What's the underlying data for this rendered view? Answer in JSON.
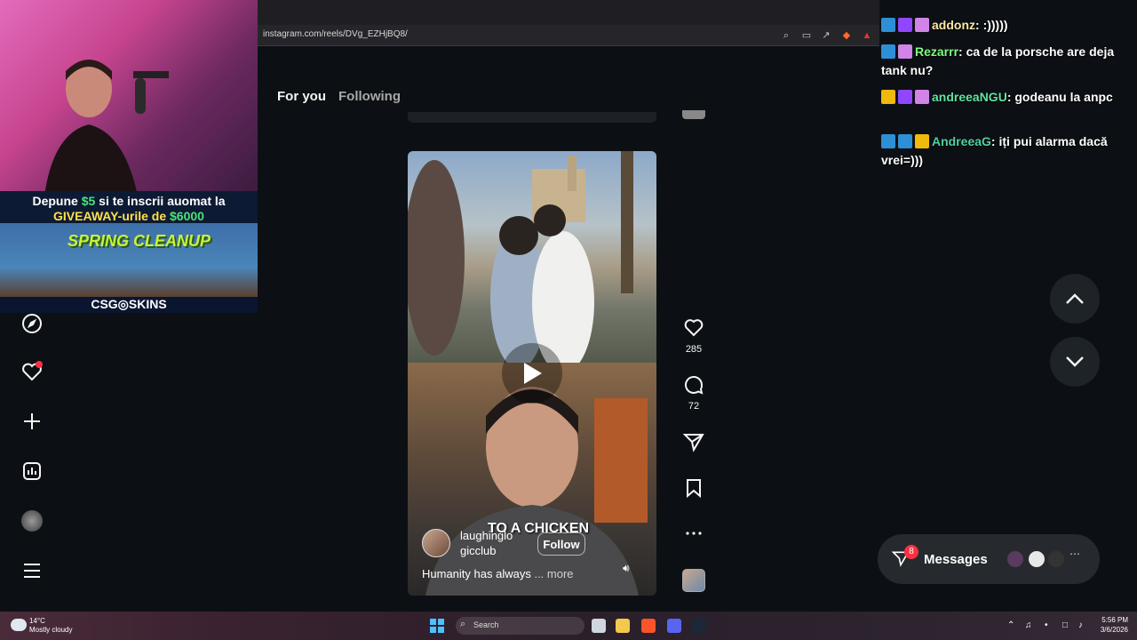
{
  "browser": {
    "url": "instagram.com/reels/DVg_EZHjBQ8/"
  },
  "feed_tabs": {
    "for_you": "For you",
    "following": "Following"
  },
  "promo": {
    "line1_prefix": "Depune ",
    "line1_amount": "$5",
    "line1_suffix": " si te inscrii auomat la",
    "line2_prefix": "GIVEAWAY-urile de ",
    "line2_amount": "$6000",
    "banner_text": "SPRING CLEANUP",
    "logo_text": "CSG◎SKINS"
  },
  "reel": {
    "overlay_caption": "TO A CHICKEN",
    "author": "laughinglo gicclub",
    "follow_label": "Follow",
    "description": "Humanity has always",
    "more_label": "... more"
  },
  "actions": {
    "likes": "285",
    "comments": "72"
  },
  "chat": [
    {
      "user": "addonz",
      "message": ":)))))",
      "color": "#f9e7a2",
      "badges": [
        "b-blue",
        "b-purple",
        "b-gift"
      ]
    },
    {
      "user": "Rezarrr",
      "message": "ca de la porsche are deja tank nu?",
      "color": "#7dff7d",
      "badges": [
        "b-blue",
        "b-gift"
      ]
    },
    {
      "user": "andreeaNGU",
      "message": "godeanu la anpc",
      "color": "#5fe3a1",
      "badges": [
        "b-crown",
        "b-purple",
        "b-gift"
      ]
    },
    {
      "user": "AndreeaG",
      "message": "iți pui alarma dacă vrei=)))",
      "color": "#4fd1a1",
      "badges": [
        "b-blue",
        "b-blue",
        "b-crown"
      ]
    }
  ],
  "messages": {
    "label": "Messages",
    "badge_count": "8"
  },
  "taskbar": {
    "weather_temp": "14°C",
    "weather_desc": "Mostly cloudy",
    "search_placeholder": "Search",
    "time": "5:56 PM",
    "date": "3/6/2026"
  }
}
